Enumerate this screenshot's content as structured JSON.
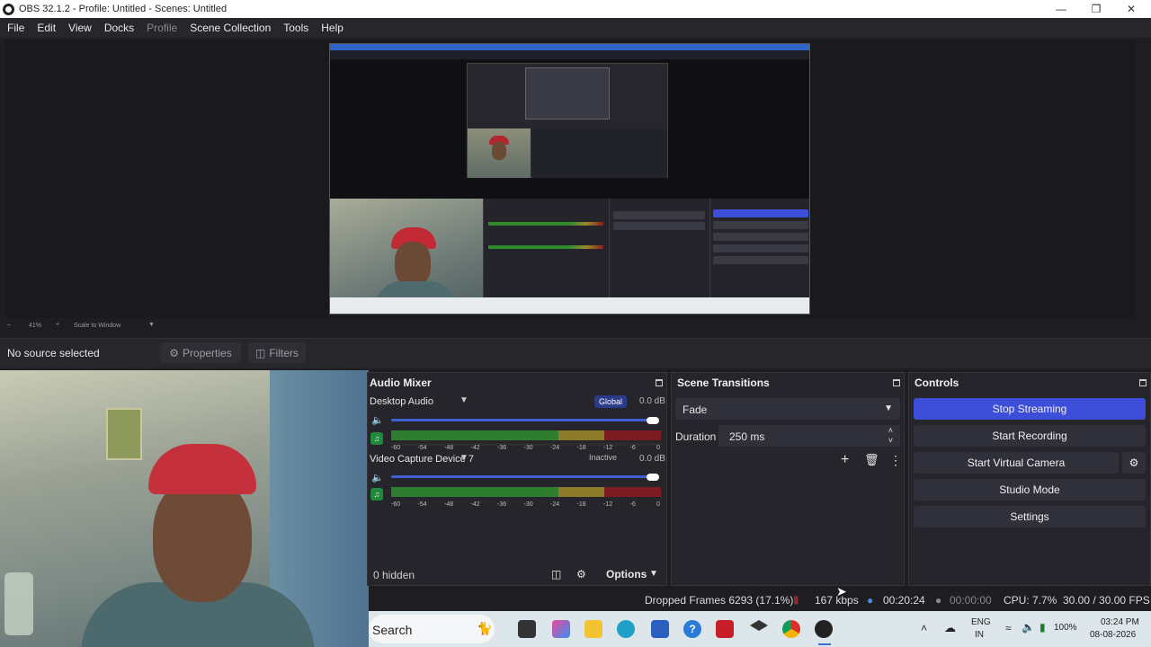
{
  "window": {
    "title": "OBS 32.1.2 - Profile: Untitled - Scenes: Untitled",
    "minimize": "—",
    "restore": "❐",
    "close": "✕"
  },
  "menu": [
    "File",
    "Edit",
    "View",
    "Docks",
    "Profile",
    "Scene Collection",
    "Tools",
    "Help"
  ],
  "preview_toolbar": {
    "zoom": "41%",
    "scale_mode": "Scale to Window"
  },
  "source_toolbar": {
    "no_source": "No source selected",
    "properties": "Properties",
    "filters": "Filters"
  },
  "audio_mixer": {
    "title": "Audio Mixer",
    "channels": [
      {
        "name": "Desktop Audio",
        "badge": "Global",
        "db": "0.0 dB"
      },
      {
        "name": "Video Capture Device 7",
        "badge": "Inactive",
        "db": "0.0 dB"
      }
    ],
    "scale": [
      "-60",
      "-54",
      "-48",
      "-42",
      "-36",
      "-30",
      "-24",
      "-18",
      "-12",
      "-6",
      "0"
    ],
    "hidden": "0 hidden",
    "options": "Options"
  },
  "scene_transitions": {
    "title": "Scene Transitions",
    "transition": "Fade",
    "duration_label": "Duration",
    "duration_value": "250 ms"
  },
  "controls": {
    "title": "Controls",
    "stop_streaming": "Stop Streaming",
    "start_recording": "Start Recording",
    "start_virtual_camera": "Start Virtual Camera",
    "studio_mode": "Studio Mode",
    "settings": "Settings"
  },
  "status": {
    "dropped_frames": "Dropped Frames 6293 (17.1%)",
    "bitrate": "167 kbps",
    "stream_time": "00:20:24",
    "record_time": "00:00:00",
    "cpu": "CPU: 7.7%",
    "fps": "30.00 / 30.00 FPS"
  },
  "taskbar": {
    "search": "Search",
    "lang": "ENG",
    "region": "IN",
    "battery": "100%",
    "time": "03:24 PM",
    "date": "08-08-2026"
  },
  "colors": {
    "accent": "#3d4fd8",
    "meter_green": "#2f7e2f",
    "meter_yellow": "#8d7a2b",
    "meter_red": "#7d1b22"
  }
}
